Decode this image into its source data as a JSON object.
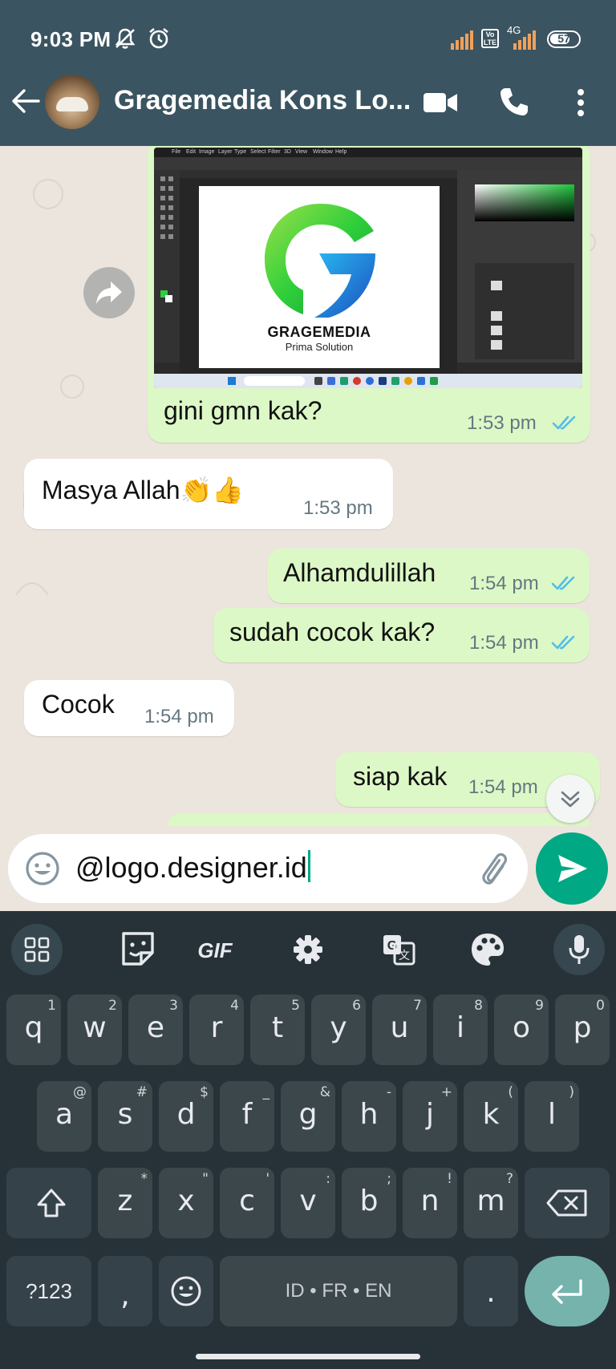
{
  "status_bar": {
    "time": "9:03 PM",
    "network": "4G",
    "volte": "Vo LTE",
    "battery": "57"
  },
  "header": {
    "title": "Gragemedia Kons Lo..."
  },
  "image_message": {
    "logo_name": "GRAGEMEDIA",
    "logo_sub": "Prima Solution",
    "caption": "gini gmn kak?",
    "time": "1:53 pm",
    "ps_menu": [
      "File",
      "Edit",
      "Image",
      "Layer",
      "Type",
      "Select",
      "Filter",
      "3D",
      "View",
      "Window",
      "Help"
    ]
  },
  "messages": [
    {
      "text": "Masya Allah👏👍",
      "time": "1:53 pm",
      "direction": "in"
    },
    {
      "text": "Alhamdulillah",
      "time": "1:54 pm",
      "direction": "out",
      "status": "read"
    },
    {
      "text": "sudah cocok kak?",
      "time": "1:54 pm",
      "direction": "out",
      "status": "read"
    },
    {
      "text": "Cocok",
      "time": "1:54 pm",
      "direction": "in"
    },
    {
      "text": "siap kak",
      "time": "1:54 pm",
      "direction": "out",
      "status": "read"
    }
  ],
  "composer": {
    "value": "@logo.designer.id"
  },
  "keyboard": {
    "toolbar": [
      "apps-icon",
      "sticker-icon",
      "GIF",
      "settings-icon",
      "translate-icon",
      "palette-icon",
      "mic-icon"
    ],
    "row1": [
      {
        "k": "q",
        "h": "1"
      },
      {
        "k": "w",
        "h": "2"
      },
      {
        "k": "e",
        "h": "3"
      },
      {
        "k": "r",
        "h": "4"
      },
      {
        "k": "t",
        "h": "5"
      },
      {
        "k": "y",
        "h": "6"
      },
      {
        "k": "u",
        "h": "7"
      },
      {
        "k": "i",
        "h": "8"
      },
      {
        "k": "o",
        "h": "9"
      },
      {
        "k": "p",
        "h": "0"
      }
    ],
    "row2": [
      {
        "k": "a",
        "h": "@"
      },
      {
        "k": "s",
        "h": "#"
      },
      {
        "k": "d",
        "h": "$"
      },
      {
        "k": "f",
        "h": "_"
      },
      {
        "k": "g",
        "h": "&"
      },
      {
        "k": "h",
        "h": "-"
      },
      {
        "k": "j",
        "h": "+"
      },
      {
        "k": "k",
        "h": "("
      },
      {
        "k": "l",
        "h": ")"
      }
    ],
    "row3": [
      {
        "k": "z",
        "h": "*"
      },
      {
        "k": "x",
        "h": "\""
      },
      {
        "k": "c",
        "h": "'"
      },
      {
        "k": "v",
        "h": ":"
      },
      {
        "k": "b",
        "h": ";"
      },
      {
        "k": "n",
        "h": "!"
      },
      {
        "k": "m",
        "h": "?"
      }
    ],
    "symbols_label": "?123",
    "comma": ",",
    "period": ".",
    "space_label": "ID • FR • EN"
  },
  "colors": {
    "header": "#3b5461",
    "outgoing": "#dcf8c6",
    "incoming": "#ffffff",
    "accent": "#00a884",
    "ticks": "#53bdeb"
  }
}
